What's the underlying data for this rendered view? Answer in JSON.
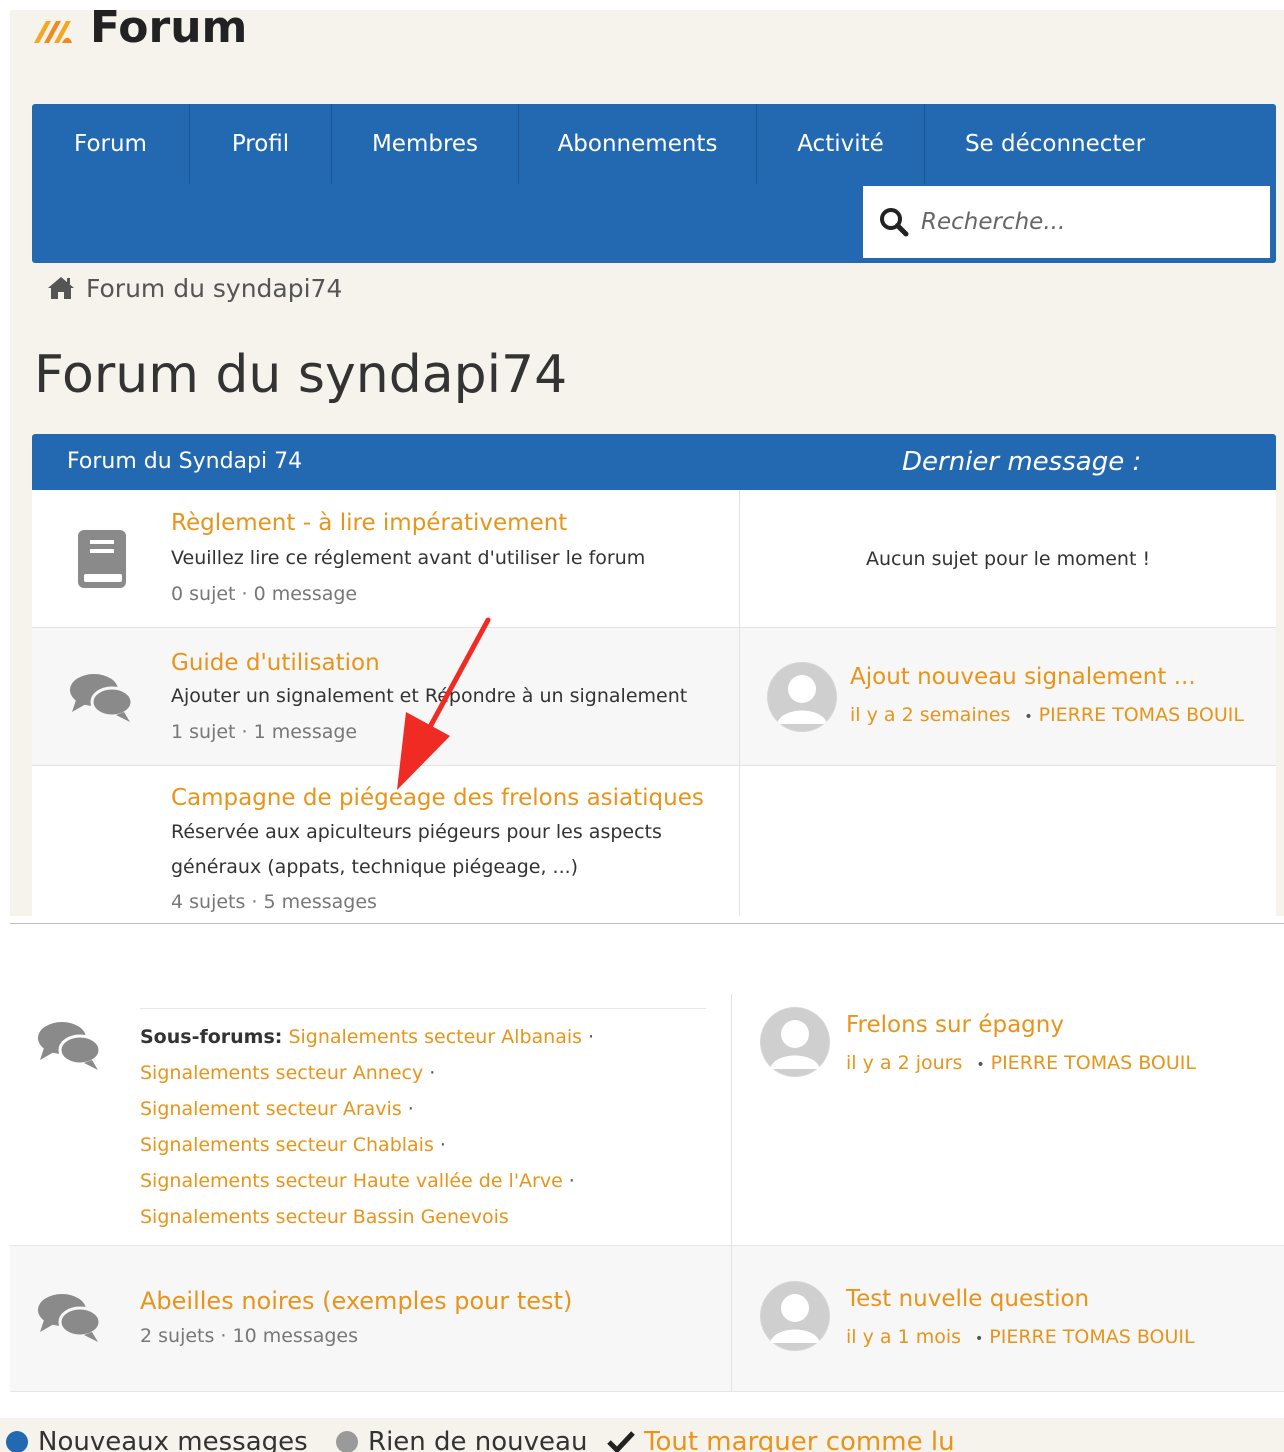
{
  "header": {
    "site_title": "Forum"
  },
  "nav": {
    "items": [
      "Forum",
      "Profil",
      "Membres",
      "Abonnements",
      "Activité",
      "Se déconnecter"
    ],
    "search_placeholder": "Recherche..."
  },
  "breadcrumb": {
    "home_label": "Forum du syndapi74"
  },
  "page_title": "Forum du syndapi74",
  "forum_table": {
    "header_left": "Forum du Syndapi 74",
    "header_right": "Dernier message :",
    "rows": [
      {
        "icon": "book-icon",
        "title": "Règlement - à lire impérativement",
        "description": "Veuillez lire ce réglement avant d'utiliser le forum",
        "stats": "0 sujet · 0 message",
        "last": {
          "empty_text": "Aucun sujet pour le moment !"
        }
      },
      {
        "icon": "comments-icon",
        "title": "Guide d'utilisation",
        "description": "Ajouter un signalement et Répondre à un signalement",
        "stats": "1 sujet · 1 message",
        "last": {
          "title": "Ajout nouveau signalement ...",
          "time": "il y a 2 semaines",
          "author": "PIERRE TOMAS BOUIL"
        }
      },
      {
        "title": "Campagne de piégeage des frelons asiatiques",
        "description_1": "Réservée aux apiculteurs piégeurs pour les aspects",
        "description_2": "généraux (appats, technique piégeage, ...)",
        "stats": "4 sujets · 5 messages"
      }
    ]
  },
  "lower_table": {
    "rows": [
      {
        "icon": "comments-icon",
        "subforums_label": "Sous-forums:",
        "subforums": [
          "Signalements secteur Albanais",
          "Signalements secteur Annecy",
          "Signalement secteur Aravis",
          "Signalements secteur Chablais",
          "Signalements secteur Haute vallée de l'Arve",
          "Signalements secteur Bassin Genevois"
        ],
        "last": {
          "title": "Frelons sur épagny",
          "time": "il y a 2 jours",
          "author": "PIERRE TOMAS BOUIL"
        }
      },
      {
        "icon": "comments-icon",
        "title": "Abeilles noires (exemples pour test)",
        "stats": "2 sujets · 10 messages",
        "last": {
          "title": "Test nuvelle question",
          "time": "il y a 1 mois",
          "author": "PIERRE TOMAS BOUIL"
        }
      }
    ]
  },
  "legend": {
    "new_messages": "Nouveaux messages",
    "nothing_new": "Rien de nouveau",
    "mark_all_read": "Tout marquer comme lu"
  },
  "colors": {
    "nav_blue": "#2369b2",
    "link_orange": "#e8941a",
    "page_bg": "#f6f3ec",
    "annotation_arrow": "#ef2b24"
  }
}
